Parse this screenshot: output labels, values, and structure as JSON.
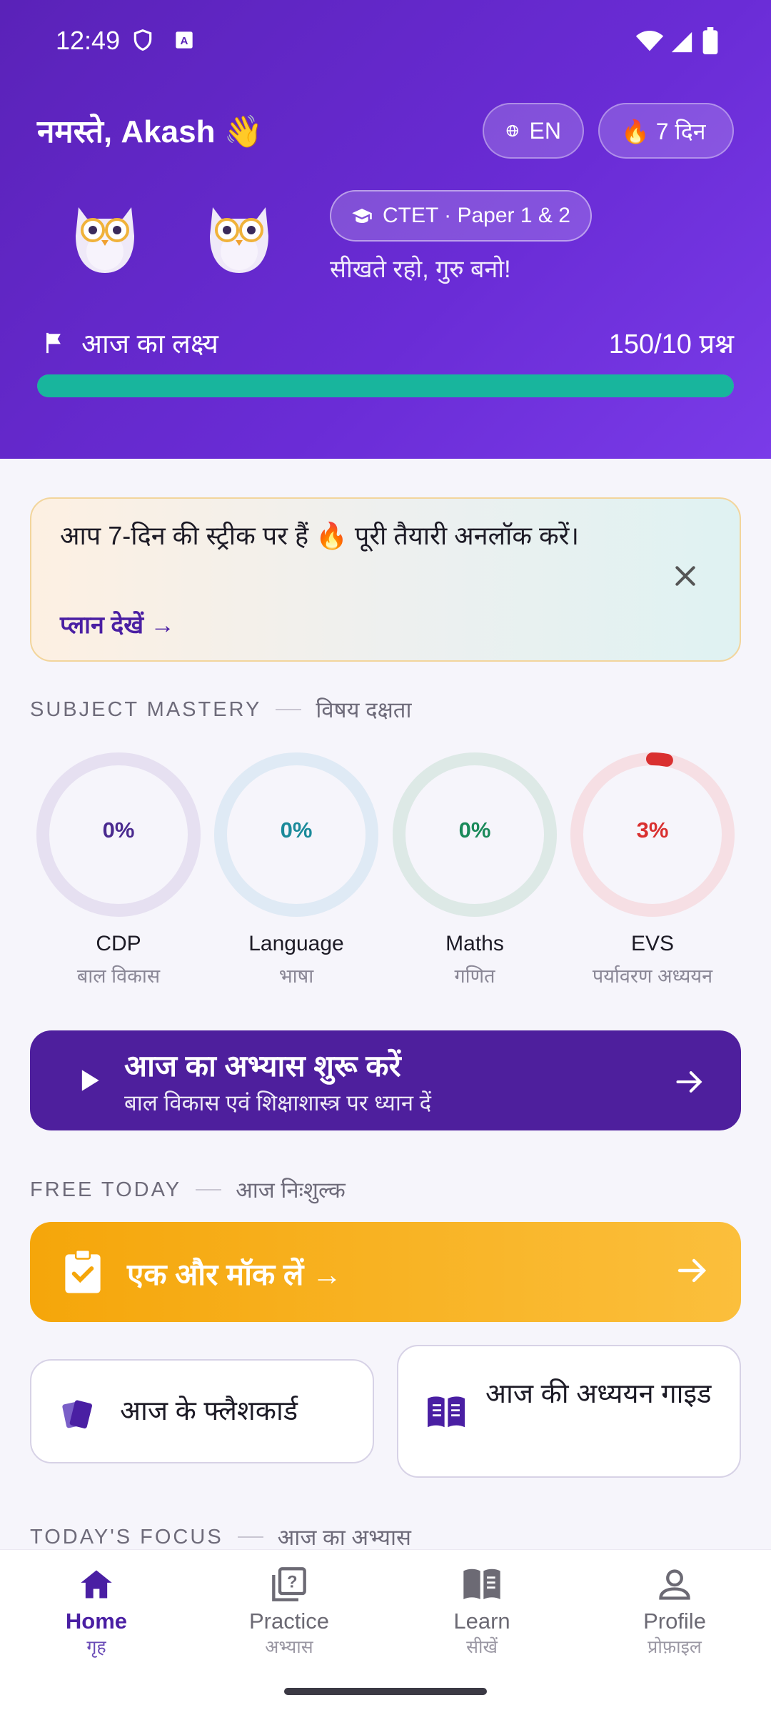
{
  "status": {
    "time": "12:49"
  },
  "header": {
    "greeting": "नमस्ते, Akash 👋",
    "lang_label": "EN",
    "streak_label": "🔥 7 दिन",
    "exam_label": "CTET · Paper 1 & 2",
    "motto": "सीखते रहो, गुरु बनो!",
    "goal_label": "आज का लक्ष्य",
    "goal_value": "150/10 प्रश्न",
    "goal_progress": 1.0
  },
  "streak_banner": {
    "text": "आप 7-दिन की स्ट्रीक पर हैं 🔥 पूरी तैयारी अनलॉक करें।",
    "link": "प्लान देखें →"
  },
  "mastery": {
    "title_en": "SUBJECT MASTERY",
    "title_hi": "विषय दक्षता",
    "subjects": [
      {
        "name": "CDP",
        "sub": "बाल विकास",
        "pct_label": "0%",
        "pct": 0,
        "color": "#4a2a8f",
        "track": "#e6e0f1"
      },
      {
        "name": "Language",
        "sub": "भाषा",
        "pct_label": "0%",
        "pct": 0,
        "color": "#1a8a9a",
        "track": "#dfeaf5"
      },
      {
        "name": "Maths",
        "sub": "गणित",
        "pct_label": "0%",
        "pct": 0,
        "color": "#1a8a5a",
        "track": "#dde9e6"
      },
      {
        "name": "EVS",
        "sub": "पर्यावरण अध्ययन",
        "pct_label": "3%",
        "pct": 3,
        "color": "#d93030",
        "track": "#f6dfe4"
      }
    ]
  },
  "practice_cta": {
    "title": "आज का अभ्यास शुरू करें",
    "subtitle": "बाल विकास एवं शिक्षाशास्त्र पर ध्यान दें"
  },
  "free_today": {
    "title_en": "FREE TODAY",
    "title_hi": "आज निःशुल्क",
    "mock_label": "एक और मॉक लें →",
    "flashcards_label": "आज के फ्लैशकार्ड",
    "study_guide_label": "आज की अध्ययन गाइड"
  },
  "focus": {
    "title_en": "TODAY'S FOCUS",
    "title_hi": "आज का अभ्यास"
  },
  "nav": [
    {
      "en": "Home",
      "hi": "गृह"
    },
    {
      "en": "Practice",
      "hi": "अभ्यास"
    },
    {
      "en": "Learn",
      "hi": "सीखें"
    },
    {
      "en": "Profile",
      "hi": "प्रोफ़ाइल"
    }
  ],
  "icons": [
    "shield-icon",
    "accessibility-icon",
    "wifi-icon",
    "signal-icon",
    "battery-icon",
    "globe-icon",
    "cap-icon",
    "flag-icon",
    "close-icon",
    "play-icon",
    "arrow-right-icon",
    "clipboard-check-icon",
    "flashcards-icon",
    "book-icon",
    "home-icon",
    "practice-icon",
    "learn-icon",
    "profile-icon"
  ]
}
